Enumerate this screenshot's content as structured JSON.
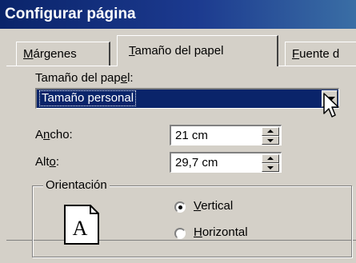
{
  "window": {
    "title": "Configurar página"
  },
  "tabs": [
    {
      "label": "Márgenes",
      "accel": "M",
      "rest": "árgenes",
      "selected": false
    },
    {
      "label": "Tamaño del papel",
      "accel": "T",
      "rest": "amaño del papel",
      "selected": true
    },
    {
      "label": "Fuente de",
      "accel": "F",
      "rest": "uente d",
      "selected": false
    }
  ],
  "paper_size": {
    "label_pre": "Tamaño del pap",
    "label_accel": "e",
    "label_post": "l:",
    "label": "Tamaño del papel:",
    "selected_value": "Tamaño personal"
  },
  "width_field": {
    "label_pre": "A",
    "label_accel": "n",
    "label_post": "cho:",
    "label": "Ancho:",
    "value": "21 cm"
  },
  "height_field": {
    "label_pre": "Alt",
    "label_accel": "o",
    "label_post": ":",
    "label": "Alto:",
    "value": "29,7 cm"
  },
  "orientation": {
    "legend": "Orientación",
    "page_glyph": "A",
    "options": [
      {
        "label": "Vertical",
        "accel": "V",
        "rest": "ertical",
        "checked": true
      },
      {
        "label": "Horizontal",
        "accel": "H",
        "rest": "orizontal",
        "checked": false
      }
    ]
  },
  "icons": [
    "dropdown-arrow-icon",
    "mouse-cursor-icon",
    "spin-up-icon",
    "spin-down-icon",
    "portrait-page-icon"
  ],
  "colors": {
    "titlebar": "#0a246a",
    "dialog_bg": "#d4d0c8",
    "selection": "#0a246a"
  }
}
